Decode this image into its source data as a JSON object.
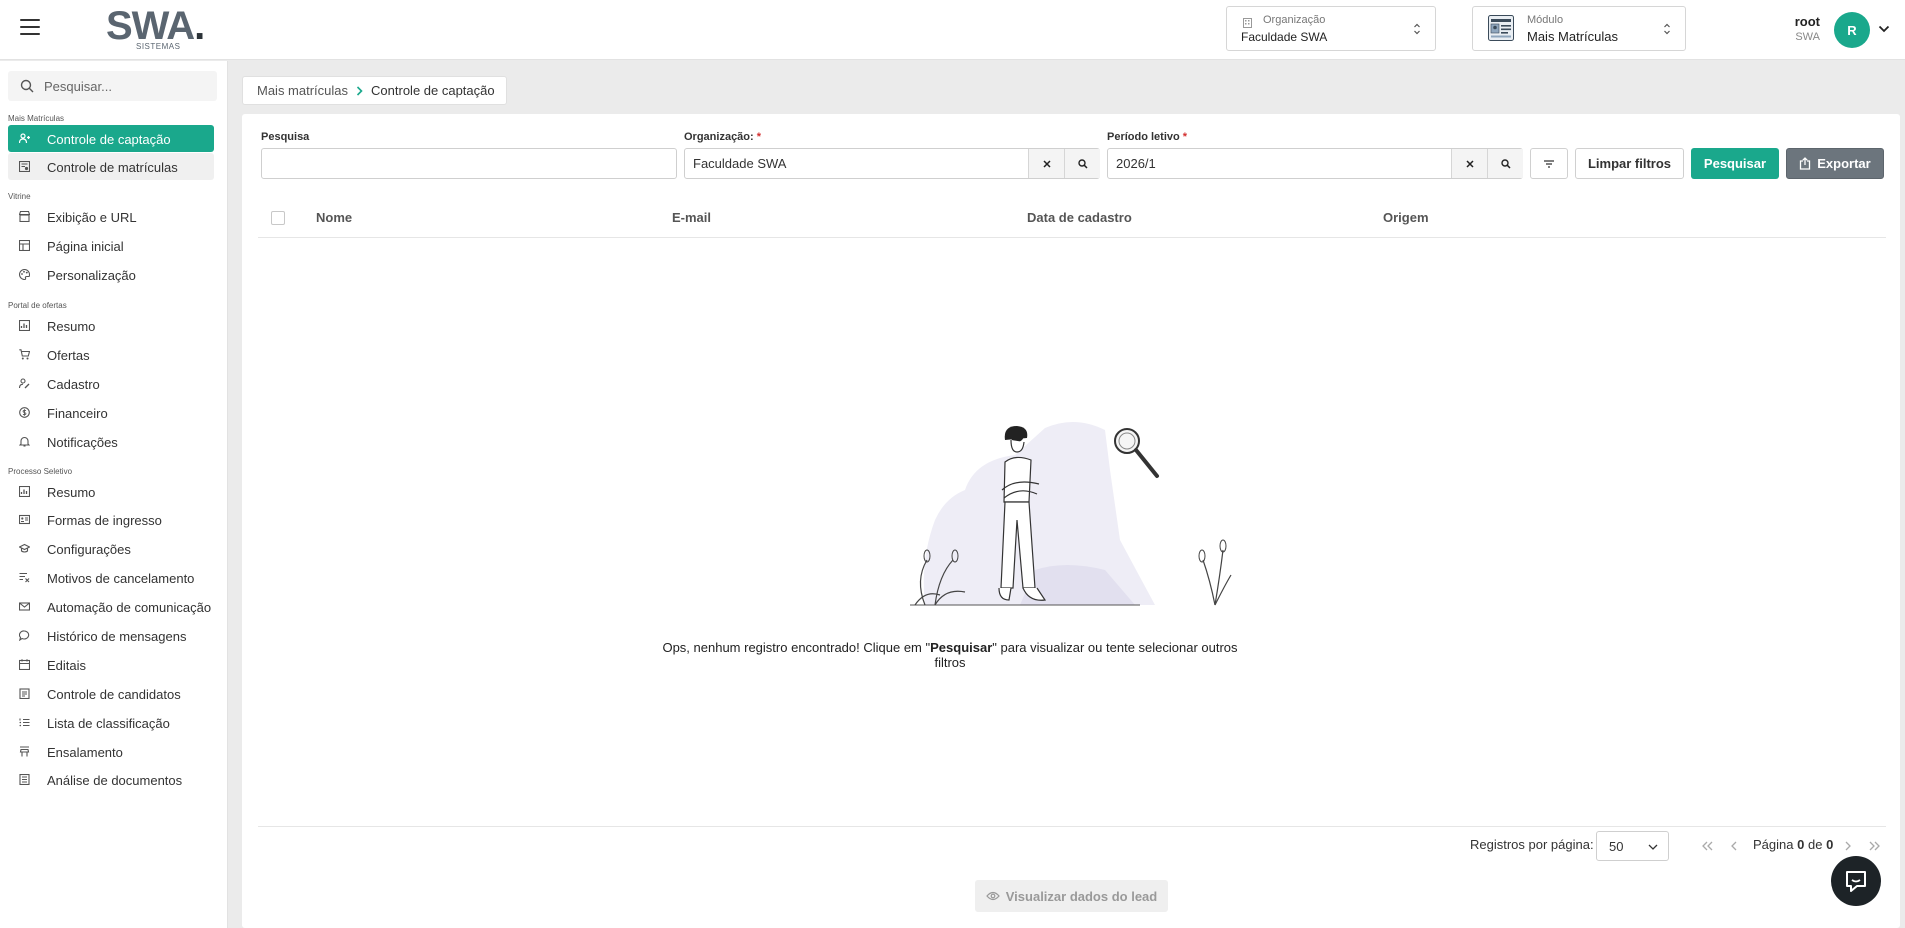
{
  "header": {
    "logo_text": "SWA",
    "logo_dot": ".",
    "logo_sub": "SISTEMAS",
    "org_selector": {
      "label": "Organização",
      "value": "Faculdade SWA"
    },
    "module_selector": {
      "label": "Módulo",
      "value": "Mais Matrículas"
    },
    "user": {
      "name": "root",
      "org": "SWA",
      "initial": "R"
    }
  },
  "sidebar": {
    "search_placeholder": "Pesquisar...",
    "sections": [
      {
        "label": "Mais Matrículas",
        "items": [
          {
            "label": "Controle de captação",
            "icon": "user-plus-icon",
            "active": true
          },
          {
            "label": "Controle de matrículas",
            "icon": "enrollment-icon"
          }
        ]
      },
      {
        "label": "Vitrine",
        "items": [
          {
            "label": "Exibição e URL",
            "icon": "storefront-icon"
          },
          {
            "label": "Página inicial",
            "icon": "layout-icon"
          },
          {
            "label": "Personalização",
            "icon": "palette-icon"
          }
        ]
      },
      {
        "label": "Portal de ofertas",
        "items": [
          {
            "label": "Resumo",
            "icon": "summary-icon"
          },
          {
            "label": "Ofertas",
            "icon": "cart-icon"
          },
          {
            "label": "Cadastro",
            "icon": "user-edit-icon"
          },
          {
            "label": "Financeiro",
            "icon": "dollar-icon"
          },
          {
            "label": "Notificações",
            "icon": "bell-icon"
          }
        ]
      },
      {
        "label": "Processo Seletivo",
        "items": [
          {
            "label": "Resumo",
            "icon": "summary-icon"
          },
          {
            "label": "Formas de ingresso",
            "icon": "id-card-icon"
          },
          {
            "label": "Configurações",
            "icon": "graduation-cap-icon"
          },
          {
            "label": "Motivos de cancelamento",
            "icon": "cancel-list-icon"
          },
          {
            "label": "Automação de comunicação",
            "icon": "mail-icon"
          },
          {
            "label": "Histórico de mensagens",
            "icon": "chat-icon"
          },
          {
            "label": "Editais",
            "icon": "calendar-icon"
          },
          {
            "label": "Controle de candidatos",
            "icon": "clipboard-icon"
          },
          {
            "label": "Lista de classificação",
            "icon": "ordered-list-icon"
          },
          {
            "label": "Ensalamento",
            "icon": "classroom-icon"
          },
          {
            "label": "Análise de documentos",
            "icon": "document-icon"
          }
        ]
      }
    ]
  },
  "breadcrumb": {
    "parent": "Mais matrículas",
    "current": "Controle de captação"
  },
  "filters": {
    "search": {
      "label": "Pesquisa",
      "value": ""
    },
    "organization": {
      "label": "Organização:",
      "required_mark": "*",
      "value": "Faculdade SWA"
    },
    "period": {
      "label": "Período letivo",
      "required_mark": "*",
      "value": "2026/1"
    },
    "clear_label": "Limpar filtros",
    "search_label": "Pesquisar",
    "export_label": "Exportar"
  },
  "table": {
    "columns": [
      "Nome",
      "E-mail",
      "Data de cadastro",
      "Origem"
    ],
    "rows": []
  },
  "empty_state": {
    "message_before": "Ops, nenhum registro encontrado! Clique em \"",
    "message_bold": "Pesquisar",
    "message_after": "\" para visualizar ou tente selecionar outros filtros"
  },
  "pagination": {
    "rows_per_page_label": "Registros por página:",
    "rows_per_page": "50",
    "page_label": "Página",
    "page_current": "0",
    "page_of": "de",
    "page_total": "0"
  },
  "lead_button_label": "Visualizar dados do lead",
  "colors": {
    "accent": "#1aa88c",
    "export": "#6c757d",
    "required": "#d32f2f"
  }
}
